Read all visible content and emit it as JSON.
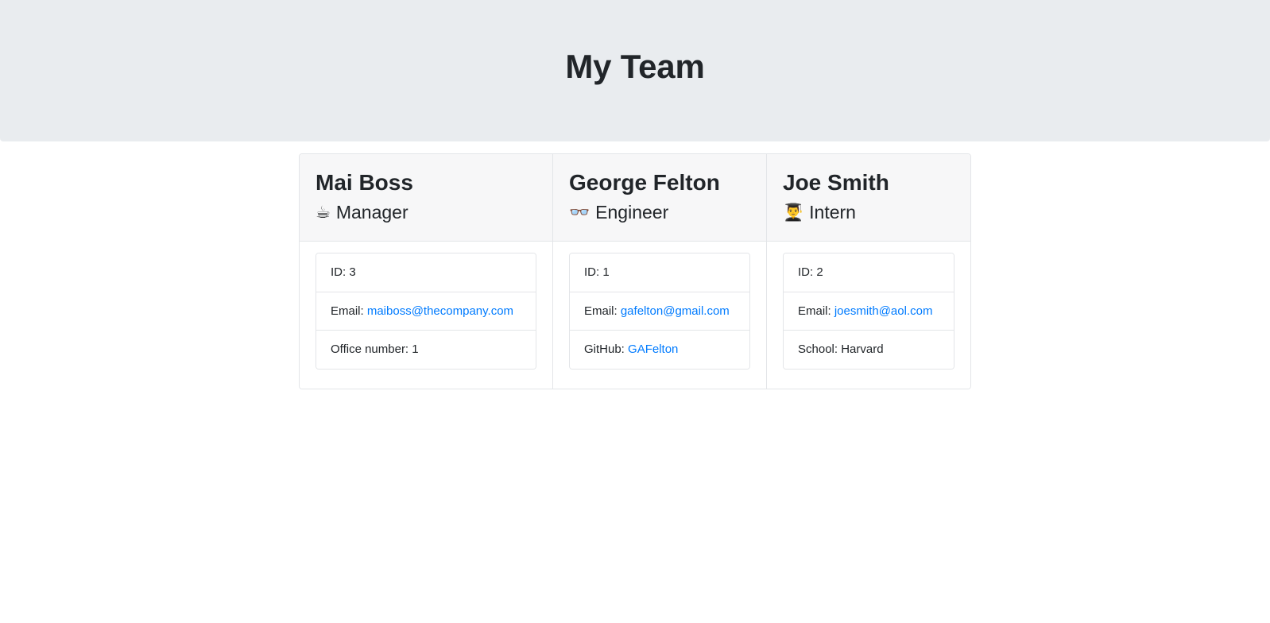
{
  "header": {
    "title": "My Team"
  },
  "team": {
    "members": [
      {
        "name": "Mai Boss",
        "role": "Manager",
        "role_icon": "coffee-cup-icon",
        "role_emoji": "☕",
        "details": [
          {
            "label": "ID: ",
            "value": "3",
            "link": false
          },
          {
            "label": "Email: ",
            "value": "maiboss@thecompany.com",
            "link": true
          },
          {
            "label": "Office number: ",
            "value": "1",
            "link": false
          }
        ]
      },
      {
        "name": "George Felton",
        "role": "Engineer",
        "role_icon": "eyeglasses-icon",
        "role_emoji": "👓",
        "details": [
          {
            "label": "ID: ",
            "value": "1",
            "link": false
          },
          {
            "label": "Email: ",
            "value": "gafelton@gmail.com",
            "link": true
          },
          {
            "label": "GitHub: ",
            "value": "GAFelton",
            "link": true
          }
        ]
      },
      {
        "name": "Joe Smith",
        "role": "Intern",
        "role_icon": "graduate-student-icon",
        "role_emoji": "👨‍🎓",
        "details": [
          {
            "label": "ID: ",
            "value": "2",
            "link": false
          },
          {
            "label": "Email: ",
            "value": "joesmith@aol.com",
            "link": true
          },
          {
            "label": "School: ",
            "value": "Harvard",
            "link": false
          }
        ]
      }
    ]
  },
  "colors": {
    "jumbotron_bg": "#e9ecef",
    "card_header_bg": "#f7f7f8",
    "border": "#e3e5e8",
    "link": "#007bff",
    "text": "#212529"
  }
}
